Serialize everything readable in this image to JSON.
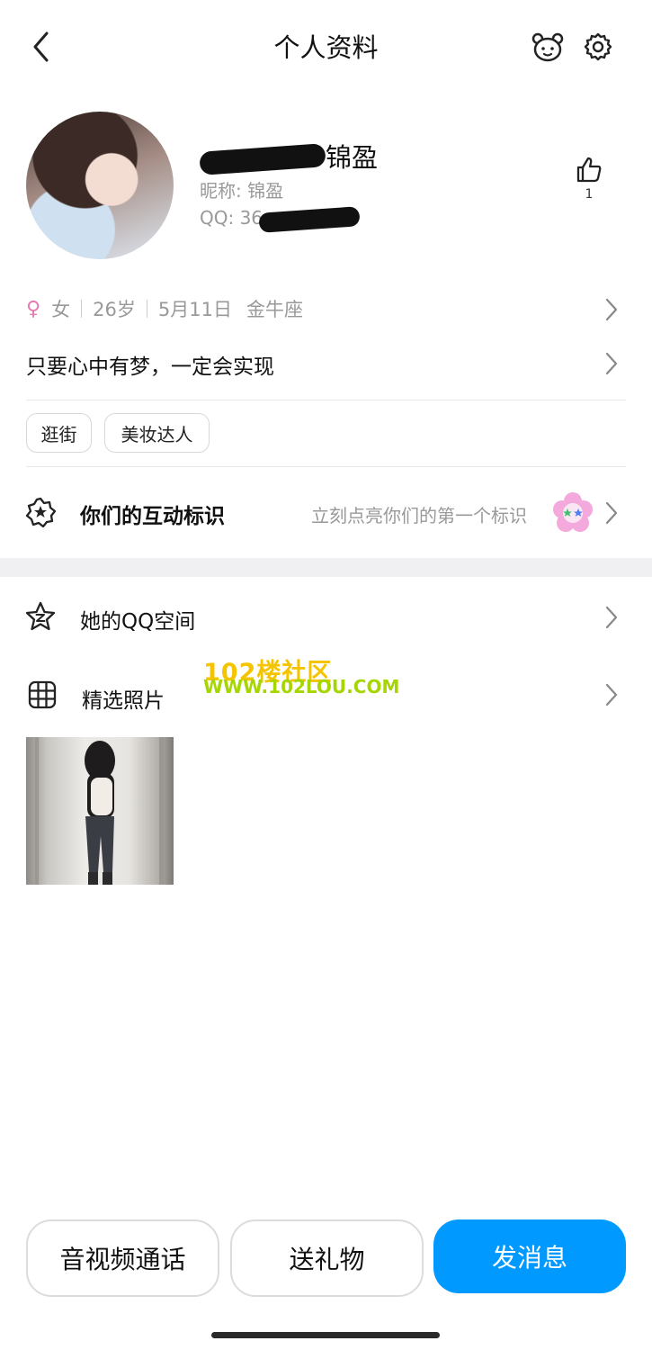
{
  "header": {
    "title": "个人资料",
    "back_icon": "chevron-left-icon",
    "pet_icon": "bear-face-icon",
    "settings_icon": "gear-icon"
  },
  "profile": {
    "name_suffix": "锦盈",
    "nickname_label": "昵称: 锦盈",
    "qq_label": "QQ: 36",
    "like_count": "1"
  },
  "info": {
    "gender_symbol": "♀",
    "gender": "女",
    "age": "26岁",
    "birthday": "5月11日",
    "zodiac": "金牛座"
  },
  "signature": "只要心中有梦，一定会实现",
  "tags": [
    "逛街",
    "美妆达人"
  ],
  "interaction": {
    "label": "你们的互动标识",
    "hint": "立刻点亮你们的第一个标识"
  },
  "rows": {
    "qzone": "她的QQ空间",
    "photos": "精选照片"
  },
  "watermark": {
    "line1": "102楼社区",
    "line2": "WWW.102LOU.COM"
  },
  "actions": {
    "call": "音视频通话",
    "gift": "送礼物",
    "message": "发消息"
  },
  "colors": {
    "primary": "#0099ff",
    "female": "#e57bb2"
  }
}
